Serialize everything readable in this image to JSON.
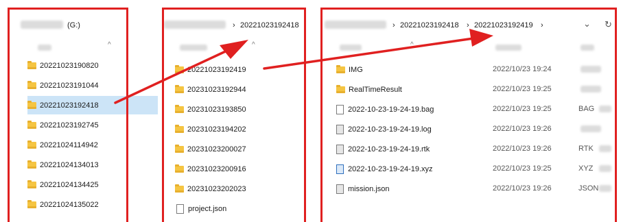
{
  "pane1": {
    "drive_label": "(G:)",
    "folders": [
      "20221023190820",
      "20221023191044",
      "20221023192418",
      "20221023192745",
      "20221024114942",
      "20221024134013",
      "20221024134425",
      "20221024135022"
    ],
    "selected": "20221023192418"
  },
  "pane2": {
    "breadcrumb": "20221023192418",
    "folders": [
      "20221023192419",
      "20231023192944",
      "20231023193850",
      "20231023194202",
      "20231023200027",
      "20231023200916",
      "20231023202023"
    ],
    "file": "project.json"
  },
  "pane3": {
    "breadcrumb": [
      "20221023192418",
      "20221023192419"
    ],
    "items": [
      {
        "name": "IMG",
        "date": "2022/10/23 19:24",
        "type": "",
        "kind": "folder"
      },
      {
        "name": "RealTimeResult",
        "date": "2022/10/23 19:25",
        "type": "",
        "kind": "folder"
      },
      {
        "name": "2022-10-23-19-24-19.bag",
        "date": "2022/10/23 19:25",
        "type": "BAG",
        "kind": "file"
      },
      {
        "name": "2022-10-23-19-24-19.log",
        "date": "2022/10/23 19:26",
        "type": "",
        "kind": "log"
      },
      {
        "name": "2022-10-23-19-24-19.rtk",
        "date": "2022/10/23 19:26",
        "type": "RTK",
        "kind": "log"
      },
      {
        "name": "2022-10-23-19-24-19.xyz",
        "date": "2022/10/23 19:25",
        "type": "XYZ",
        "kind": "xyz"
      },
      {
        "name": "mission.json",
        "date": "2022/10/23 19:26",
        "type": "JSON",
        "kind": "log"
      }
    ]
  },
  "icons": {
    "chevron_right": "›",
    "chevron_down": "⌄",
    "refresh": "↻",
    "sort_up": "^"
  },
  "colors": {
    "highlight": "#e02020",
    "selection": "#cce4f7",
    "folder": "#f5c542"
  }
}
